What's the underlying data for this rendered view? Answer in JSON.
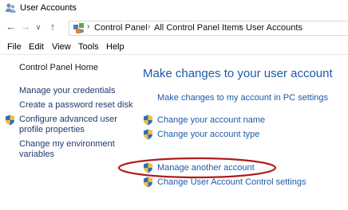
{
  "window": {
    "title": "User Accounts"
  },
  "nav": {
    "back_icon": "back-arrow-icon",
    "forward_icon": "forward-arrow-icon",
    "recent_icon": "chevron-down-icon",
    "up_icon": "up-arrow-icon"
  },
  "breadcrumb": {
    "items": [
      "Control Panel",
      "All Control Panel Items",
      "User Accounts"
    ]
  },
  "menu": {
    "items": [
      "File",
      "Edit",
      "View",
      "Tools",
      "Help"
    ]
  },
  "sidebar": {
    "home": "Control Panel Home",
    "links": [
      "Manage your credentials",
      "Create a password reset disk"
    ],
    "advanced_line1": "Configure advanced user",
    "advanced_line2": "profile properties",
    "env_line1": "Change my environment",
    "env_line2": "variables"
  },
  "main": {
    "heading": "Make changes to your user account",
    "pc_settings_link": "Make changes to my account in PC settings",
    "change_name": "Change your account name",
    "change_type": "Change your account type",
    "manage_another": "Manage another account",
    "uac_settings": "Change User Account Control settings"
  },
  "colors": {
    "link": "#1e5aa8",
    "heading": "#1e5aa8",
    "sidebar_link": "#1e3a6e",
    "highlight": "#b01c1c"
  }
}
